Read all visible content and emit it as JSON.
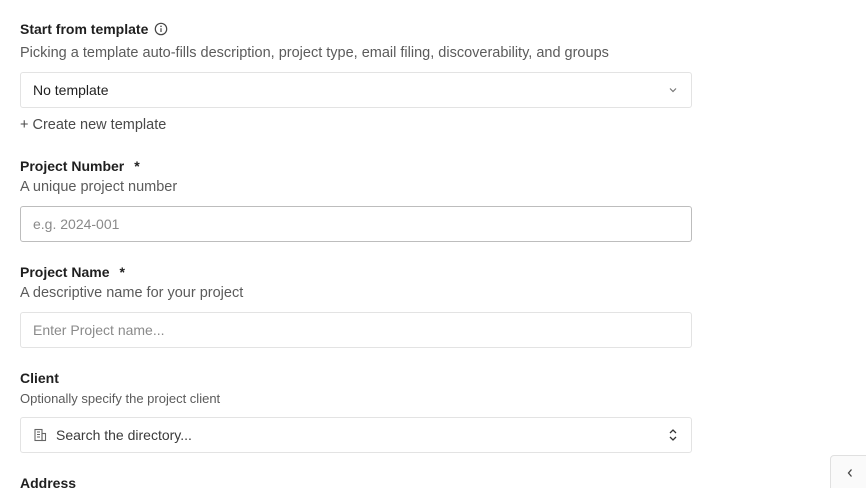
{
  "template": {
    "label": "Start from template",
    "description": "Picking a template auto-fills description, project type, email filing, discoverability, and groups",
    "selected": "No template",
    "create_link": "+ Create new template"
  },
  "project_number": {
    "label": "Project Number",
    "required_mark": "*",
    "description": "A unique project number",
    "placeholder": "e.g. 2024-001"
  },
  "project_name": {
    "label": "Project Name",
    "required_mark": "*",
    "description": "A descriptive name for your project",
    "placeholder": "Enter Project name..."
  },
  "client": {
    "label": "Client",
    "description": "Optionally specify the project client",
    "placeholder": "Search the directory..."
  },
  "address": {
    "label": "Address"
  },
  "icons": {
    "template_info": "info-icon",
    "template_select": "chevron-down-icon",
    "client_prefix": "building-icon",
    "client_select": "chevron-up-down-icon",
    "panel_collapse": "chevron-left-icon"
  }
}
